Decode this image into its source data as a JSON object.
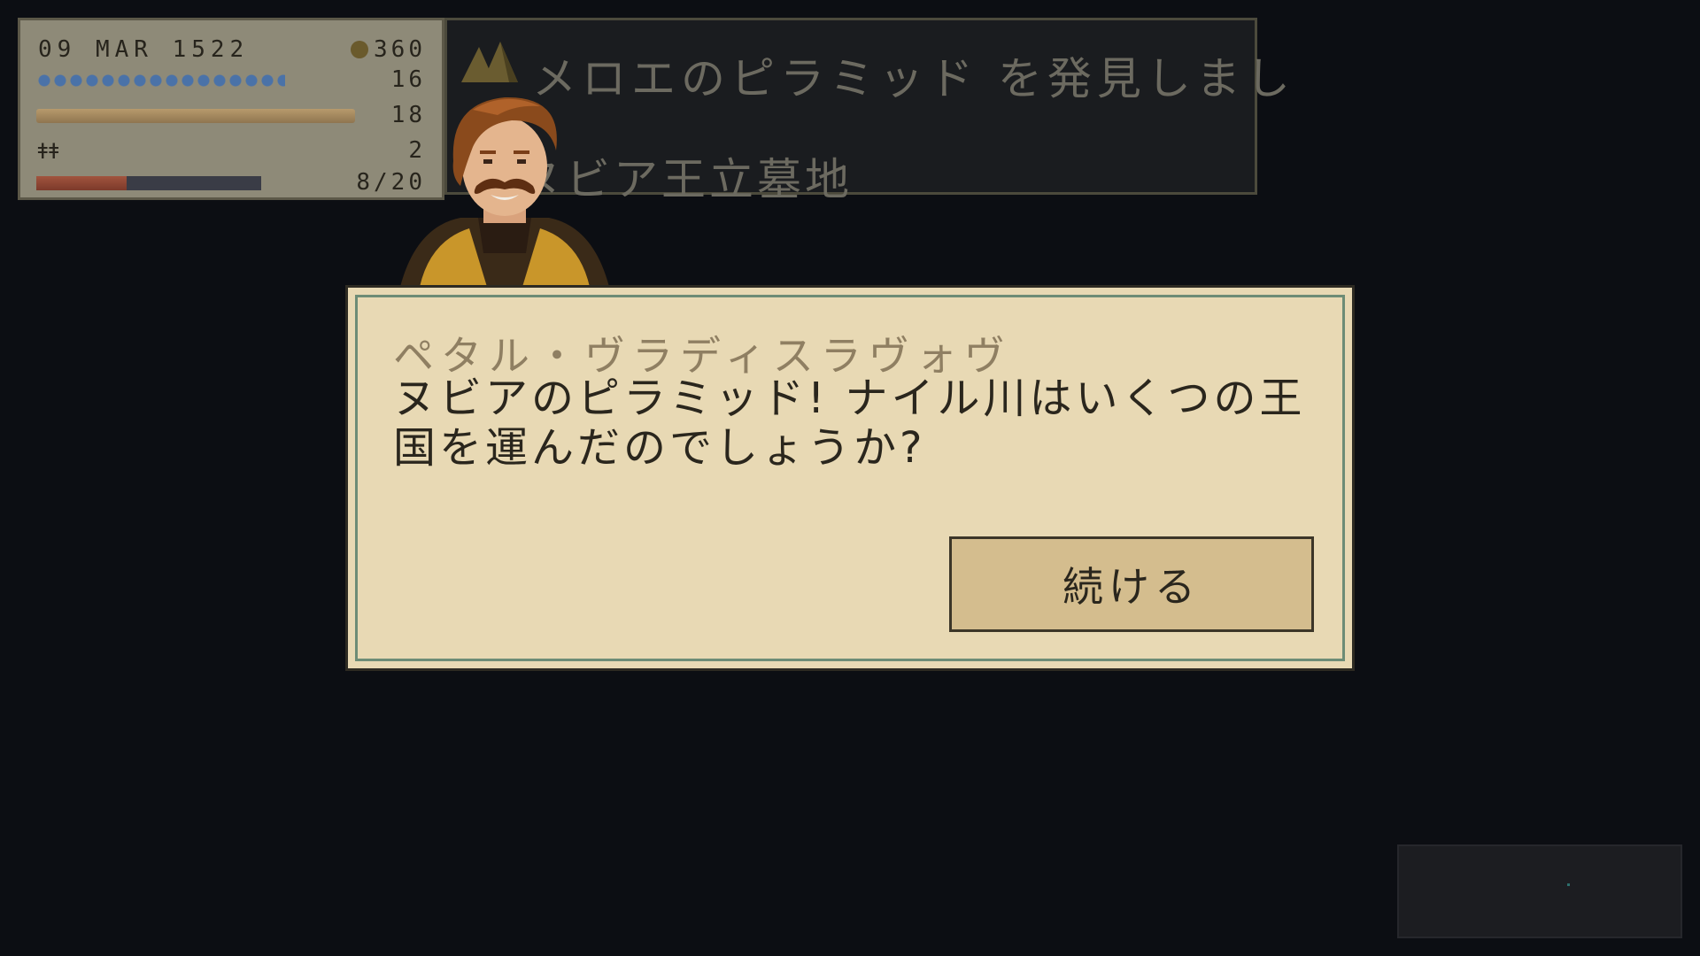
{
  "status": {
    "date": "09 MAR 1522",
    "gold": "360",
    "water_value": "16",
    "water_level": 0.85,
    "food_value": "18",
    "food_level": 1.0,
    "crew_value": "2",
    "health_value": "8/20",
    "health_level": 0.4
  },
  "banner": {
    "line1": "メロエのピラミッド を発見しまし",
    "line2": "ヌビア王立墓地"
  },
  "dialog": {
    "speaker": "ペタル・ヴラディスラヴォヴ",
    "text": "ヌビアのピラミッド! ナイル川はいくつの王国を運んだのでしょうか?",
    "continue_label": "続ける"
  },
  "colors": {
    "background": "#0c0e13",
    "parchment": "#e8d9b4",
    "button": "#d4bd8e",
    "frame_green": "#6d8c76"
  }
}
